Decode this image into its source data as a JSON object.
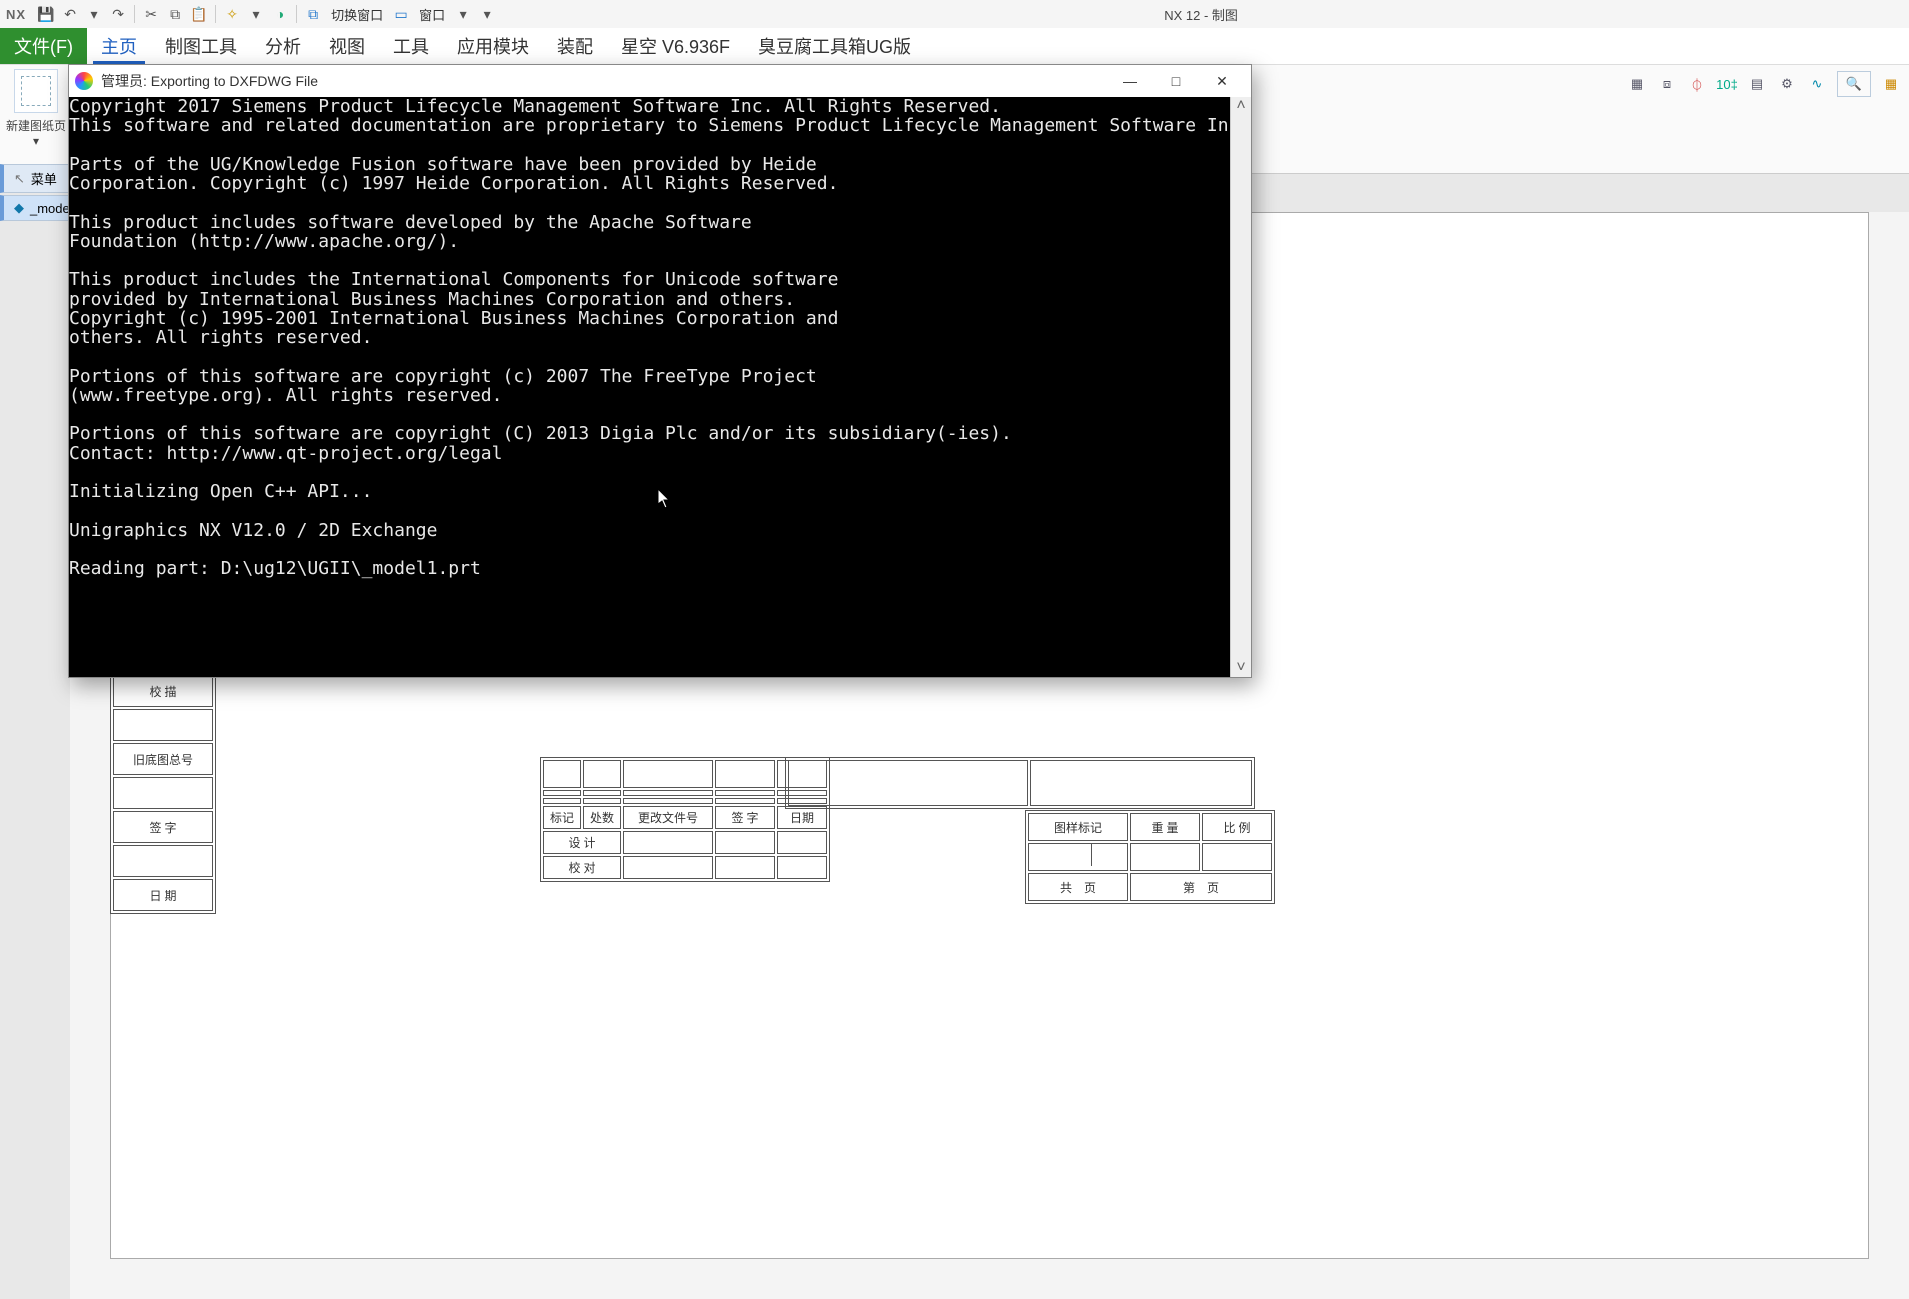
{
  "app": {
    "brand": "NX",
    "title": "NX 12 - 制图"
  },
  "qat": {
    "switch_window": "切换窗口",
    "window_menu": "窗口"
  },
  "menubar": {
    "file": "文件(F)",
    "tabs": [
      {
        "label": "主页",
        "active": true
      },
      {
        "label": "制图工具"
      },
      {
        "label": "分析"
      },
      {
        "label": "视图"
      },
      {
        "label": "工具"
      },
      {
        "label": "应用模块"
      },
      {
        "label": "装配"
      },
      {
        "label": "星空 V6.936F"
      },
      {
        "label": "臭豆腐工具箱UG版"
      }
    ]
  },
  "ribbon": {
    "new_sheet": "新建图纸页"
  },
  "left_nav": {
    "menu": "菜单",
    "model": "_mode"
  },
  "titleblock": {
    "left": {
      "row1": "校 描",
      "row2": "旧底图总号",
      "row3": "签 字",
      "row4": "日 期"
    },
    "center": {
      "mark": "标记",
      "count": "处数",
      "change": "更改文件号",
      "sign": "签 字",
      "date": "日期",
      "design": "设 计",
      "check": "校 对"
    },
    "right": {
      "spec": "图样标记",
      "weight": "重 量",
      "scale": "比 例",
      "gong": "共",
      "ye1": "页",
      "di": "第",
      "ye2": "页"
    }
  },
  "console": {
    "title_prefix": "管理员:",
    "title": "Exporting to DXFDWG File",
    "minimize": "—",
    "maximize": "□",
    "close": "✕",
    "body": "Copyright 2017 Siemens Product Lifecycle Management Software Inc. All Rights Reserved.\nThis software and related documentation are proprietary to Siemens Product Lifecycle Management Software Inc.\n\nParts of the UG/Knowledge Fusion software have been provided by Heide\nCorporation. Copyright (c) 1997 Heide Corporation. All Rights Reserved.\n\nThis product includes software developed by the Apache Software\nFoundation (http://www.apache.org/).\n\nThis product includes the International Components for Unicode software\nprovided by International Business Machines Corporation and others.\nCopyright (c) 1995-2001 International Business Machines Corporation and\nothers. All rights reserved.\n\nPortions of this software are copyright (c) 2007 The FreeType Project\n(www.freetype.org). All rights reserved.\n\nPortions of this software are copyright (C) 2013 Digia Plc and/or its subsidiary(-ies).\nContact: http://www.qt-project.org/legal\n\nInitializing Open C++ API...\n\nUnigraphics NX V12.0 / 2D Exchange\n\nReading part: D:\\ug12\\UGII\\_model1.prt"
  }
}
